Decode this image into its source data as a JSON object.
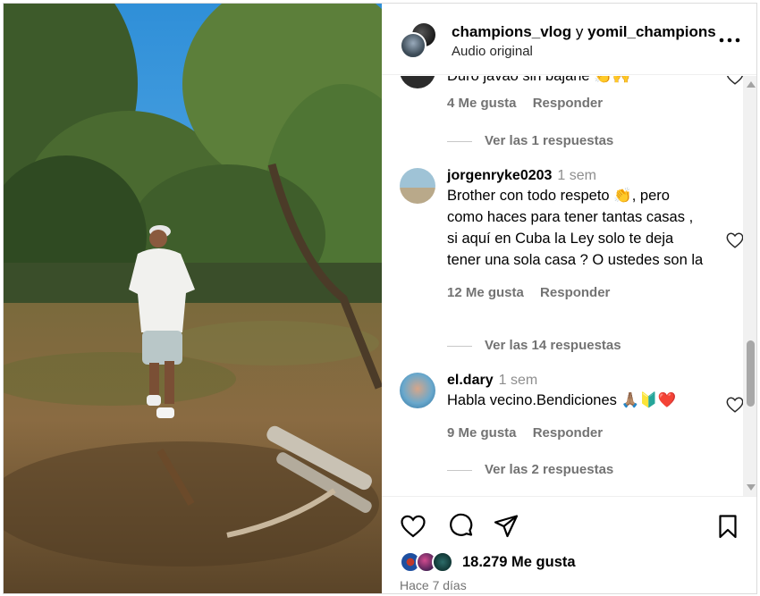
{
  "header": {
    "owner_primary": "champions_vlog",
    "connector": "y",
    "owner_secondary": "yomil_champions",
    "audio": "Audio original",
    "more_icon": "more-horizontal-icon"
  },
  "comments": [
    {
      "user": "",
      "time": "",
      "text": "Duro javao sin bajarle 👏🙌",
      "likes": "4 Me gusta",
      "reply": "Responder",
      "view_replies": "Ver las 1 respuestas"
    },
    {
      "user": "jorgenryke0203",
      "time": "1 sem",
      "text": "Brother con todo respeto 👏, pero como haces para tener tantas casas , si aquí en Cuba la Ley solo te deja tener una sola casa ? O ustedes son la",
      "likes": "12 Me gusta",
      "reply": "Responder",
      "view_replies": "Ver las 14 respuestas"
    },
    {
      "user": "el.dary",
      "time": "1 sem",
      "text": "Habla vecino.Bendiciones 🙏🏽🔰❤️",
      "likes": "9 Me gusta",
      "reply": "Responder",
      "view_replies": "Ver las 2 respuestas"
    }
  ],
  "actions": {
    "like_icon": "heart-icon",
    "comment_icon": "comment-icon",
    "share_icon": "share-icon",
    "save_icon": "bookmark-icon",
    "likes_count": "18.279 Me gusta",
    "posted_ago": "Hace 7 días"
  },
  "colors": {
    "secondary_text": "#737373",
    "border": "#dbdbdb"
  }
}
